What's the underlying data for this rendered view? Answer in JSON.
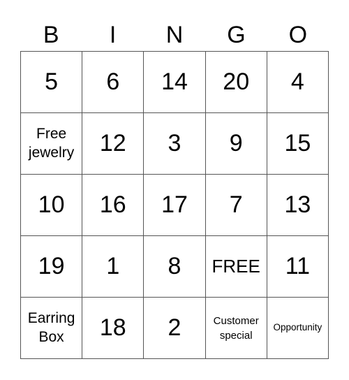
{
  "header": [
    "B",
    "I",
    "N",
    "G",
    "O"
  ],
  "cells": [
    [
      "5",
      "6",
      "14",
      "20",
      "4"
    ],
    [
      "Free jewelry",
      "12",
      "3",
      "9",
      "15"
    ],
    [
      "10",
      "16",
      "17",
      "7",
      "13"
    ],
    [
      "19",
      "1",
      "8",
      "FREE",
      "11"
    ],
    [
      "Earring Box",
      "18",
      "2",
      "Customer special",
      "Opportunity"
    ]
  ]
}
